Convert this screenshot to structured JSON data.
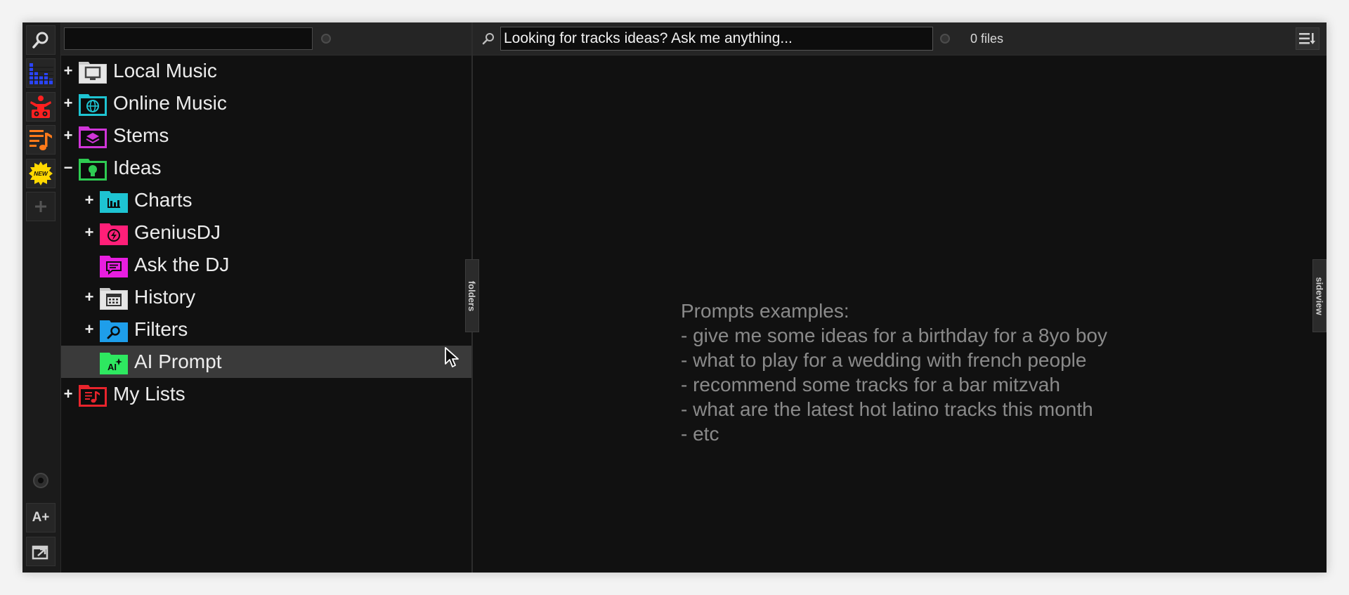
{
  "folders_search": {
    "value": "",
    "placeholder": ""
  },
  "tree": {
    "items": [
      {
        "label": "Local Music",
        "toggle": "+",
        "icon": "computer-folder-icon",
        "color": "#cccccc"
      },
      {
        "label": "Online Music",
        "toggle": "+",
        "icon": "globe-folder-icon",
        "color": "#1ec4d2"
      },
      {
        "label": "Stems",
        "toggle": "+",
        "icon": "layers-folder-icon",
        "color": "#d035d8"
      },
      {
        "label": "Ideas",
        "toggle": "−",
        "icon": "lightbulb-folder-icon",
        "color": "#2ecc52"
      },
      {
        "label": "Charts",
        "toggle": "+",
        "icon": "chart-folder-icon",
        "color": "#1ec4d2"
      },
      {
        "label": "GeniusDJ",
        "toggle": "+",
        "icon": "lightning-folder-icon",
        "color": "#ff1f78"
      },
      {
        "label": "Ask the DJ",
        "toggle": "",
        "icon": "chat-folder-icon",
        "color": "#e81ee0"
      },
      {
        "label": "History",
        "toggle": "+",
        "icon": "calendar-folder-icon",
        "color": "#cccccc"
      },
      {
        "label": "Filters",
        "toggle": "+",
        "icon": "filter-search-folder-icon",
        "color": "#1e9eea"
      },
      {
        "label": "AI Prompt",
        "toggle": "",
        "icon": "ai-sparkle-folder-icon",
        "color": "#2ee860"
      },
      {
        "label": "My Lists",
        "toggle": "+",
        "icon": "music-list-folder-icon",
        "color": "#e8242c"
      }
    ]
  },
  "side_tabs": {
    "folders": "folders",
    "sideview": "sideview"
  },
  "browser": {
    "prompt_value": "Looking for tracks ideas? Ask me anything...",
    "file_count": "0 files"
  },
  "prompt_examples": [
    "Prompts examples:",
    "- give me some ideas for a birthday for a 8yo boy",
    "- what to play for a wedding with french people",
    "- recommend some tracks for a bar mitzvah",
    "- what are the latest hot latino tracks this month",
    "- etc"
  ],
  "rail": {
    "new_badge": "NEW",
    "font_button": "A+"
  }
}
